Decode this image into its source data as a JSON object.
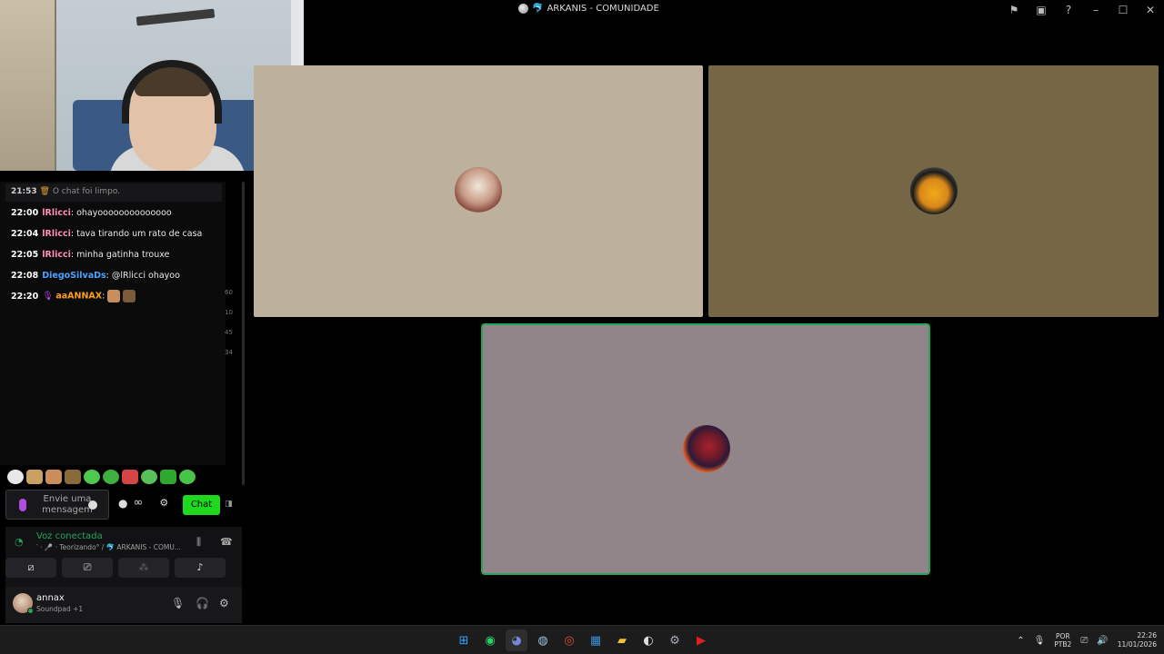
{
  "window": {
    "title": "ARKANIS - COMUNIDADE",
    "icons": [
      "flag-icon",
      "inbox-icon",
      "help-icon",
      "minimize-icon",
      "maximize-icon",
      "close-icon"
    ]
  },
  "chat": {
    "system_message": {
      "time": "21:53",
      "text": "O chat foi limpo."
    },
    "messages": [
      {
        "time": "22:00",
        "user": "lRlicci",
        "text": "ohayoooooooooooooo"
      },
      {
        "time": "22:04",
        "user": "lRlicci",
        "text": "tava tirando um rato de casa"
      },
      {
        "time": "22:05",
        "user": "lRlicci",
        "text": "minha gatinha trouxe"
      },
      {
        "time": "22:08",
        "user": "DiegoSilvaDs",
        "text": "@lRlicci ohayoo"
      },
      {
        "time": "22:20",
        "user": "aaANNAX",
        "text": ""
      }
    ],
    "scroll_numbers": [
      "60",
      "10",
      "45",
      "34"
    ],
    "input_placeholder": "Envie uma mensagem",
    "infinity": "∞",
    "chat_button": "Chat"
  },
  "voice": {
    "status": "Voz conectada",
    "channel": "‵ · 🎤 · Teorizando° / 🐬 ARKANIS - COMU...",
    "user_name": "annax",
    "user_sub": "Soundpad +1"
  },
  "taskbar": {
    "language": "POR",
    "layout": "PTB2",
    "time": "22:26",
    "date": "11/01/2026"
  },
  "colors": {
    "accent_green": "#23a55a",
    "chat_button": "#1fd91f",
    "tile1": "#bdb09d",
    "tile2": "#756646",
    "tile3": "#928589"
  }
}
